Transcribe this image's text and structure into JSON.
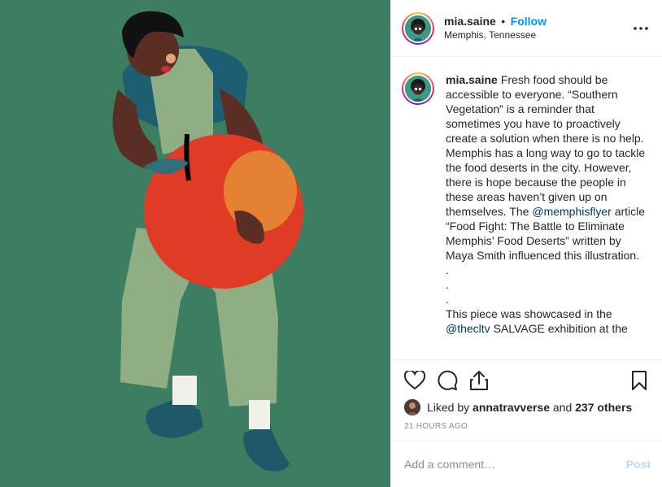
{
  "header": {
    "username": "mia.saine",
    "separator": "•",
    "follow_label": "Follow",
    "location": "Memphis, Tennessee",
    "more_icon": "more-horizontal-icon"
  },
  "caption": {
    "username": "mia.saine",
    "text_1": "Fresh food should be accessible to everyone. “Southern Vegetation” is a reminder that sometimes you have to proactively create a solution when there is no help. Memphis has a long way to go to tackle the food deserts in the city. However, there is hope because the people in these areas haven’t given up on themselves. The ",
    "mention_1": "@memphisflyer",
    "text_2": " article “Food Fight: The Battle to Eliminate Memphis’ Food Deserts” written by Maya Smith influenced this illustration.",
    "dots": [
      ".",
      ".",
      "."
    ],
    "text_3": "This piece was showcased in the ",
    "mention_2": "@thecltv",
    "text_4": " SALVAGE exhibition at the"
  },
  "actions": {
    "icons": [
      "heart-icon",
      "comment-icon",
      "share-icon",
      "bookmark-icon"
    ],
    "liked_by_prefix": "Liked by ",
    "liked_by_user": "annatravverse",
    "liked_by_middle": " and ",
    "liked_by_others": "237 others",
    "timestamp": "21 HOURS AGO"
  },
  "comment_box": {
    "placeholder": "Add a comment…",
    "post_label": "Post"
  },
  "colors": {
    "media_background": "#3d7d62",
    "link_blue": "#0095f6",
    "mention_blue": "#00376b",
    "post_disabled": "#b3dbff"
  }
}
